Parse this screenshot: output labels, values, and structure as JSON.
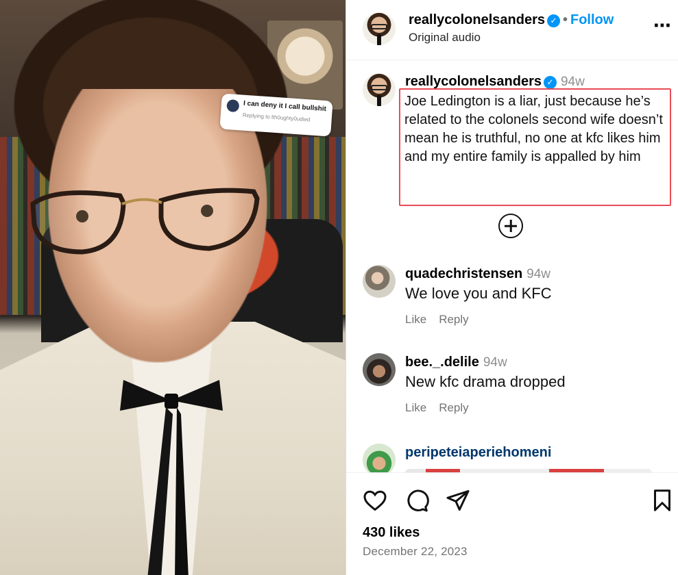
{
  "post": {
    "author": "reallycolonelsanders",
    "verified_mark": "✓",
    "header_separator": "•",
    "follow_label": "Follow",
    "audio_label": "Original audio",
    "more_icon": "⋯"
  },
  "video_overlay": {
    "reply_text": "I can deny it I call bullshit",
    "replying_to": "Replying to lth0ughty0udied"
  },
  "caption": {
    "author": "reallycolonelsanders",
    "time": "94w",
    "text": "Joe Ledington is a liar, just because he’s related to the colonels second wife doesn’t mean he is truthful, no one at kfc likes him and my entire family is appalled by him"
  },
  "comments": [
    {
      "user": "quadechristensen",
      "time": "94w",
      "text": "We love you and KFC",
      "like_label": "Like",
      "reply_label": "Reply"
    },
    {
      "user": "bee._.delile",
      "time": "94w",
      "text": "New kfc drama dropped",
      "like_label": "Like",
      "reply_label": "Reply"
    },
    {
      "user": "peripeteiaperiehomeni"
    }
  ],
  "engagement": {
    "likes_text": "430 likes",
    "date_text": "December 22, 2023"
  },
  "colors": {
    "accent": "#0095f6",
    "highlight_box": "#e84b55",
    "secondary_text": "#737373"
  },
  "icons": [
    "heart-icon",
    "comment-icon",
    "share-icon",
    "bookmark-icon",
    "add-circle-icon",
    "verified-icon",
    "more-options-icon"
  ]
}
